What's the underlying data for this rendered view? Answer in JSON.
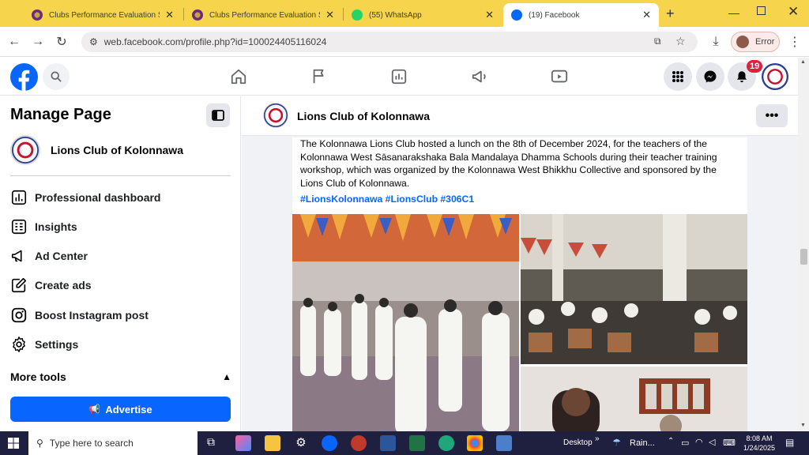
{
  "browser": {
    "tabs": [
      {
        "title": "Clubs Performance Evaluation Syst",
        "favicon": "lions-logo-icon"
      },
      {
        "title": "Clubs Performance Evaluation Syst",
        "favicon": "lions-logo-icon"
      },
      {
        "title": "(55) WhatsApp",
        "favicon": "whatsapp-icon"
      },
      {
        "title": "(19) Facebook",
        "favicon": "facebook-icon"
      }
    ],
    "url": "web.facebook.com/profile.php?id=100024405116024",
    "profile_label": "Error"
  },
  "fb": {
    "notification_count": "19"
  },
  "sidebar": {
    "title": "Manage Page",
    "page_name": "Lions Club of Kolonnawa",
    "items": [
      {
        "label": "Professional dashboard",
        "icon": "dashboard-icon"
      },
      {
        "label": "Insights",
        "icon": "insights-icon"
      },
      {
        "label": "Ad Center",
        "icon": "megaphone-icon"
      },
      {
        "label": "Create ads",
        "icon": "edit-icon"
      },
      {
        "label": "Boost Instagram post",
        "icon": "instagram-icon"
      },
      {
        "label": "Settings",
        "icon": "gear-icon"
      }
    ],
    "more_tools": "More tools",
    "advertise": "Advertise"
  },
  "main": {
    "page_name": "Lions Club of Kolonnawa",
    "post_text": "The Kolonnawa Lions Club hosted a lunch on the 8th of December 2024, for the teachers of the Kolonnawa West Sāsanarakshaka Bala Mandalaya Dhamma Schools during their teacher training workshop, which was organized by the Kolonnawa West Bhikkhu Collective and sponsored by the Lions Club of Kolonnawa.",
    "hashtags": "#LionsKolonnawa #LionsClub #306C1"
  },
  "taskbar": {
    "search_placeholder": "Type here to search",
    "desktop_label": "Desktop",
    "weather": "Rain...",
    "time": "8:08 AM",
    "date": "1/24/2025"
  },
  "colors": {
    "fb_blue": "#0866ff",
    "tabstrip": "#f6d44c",
    "taskbar": "#1f1f3f",
    "badge_red": "#e41e3f"
  }
}
